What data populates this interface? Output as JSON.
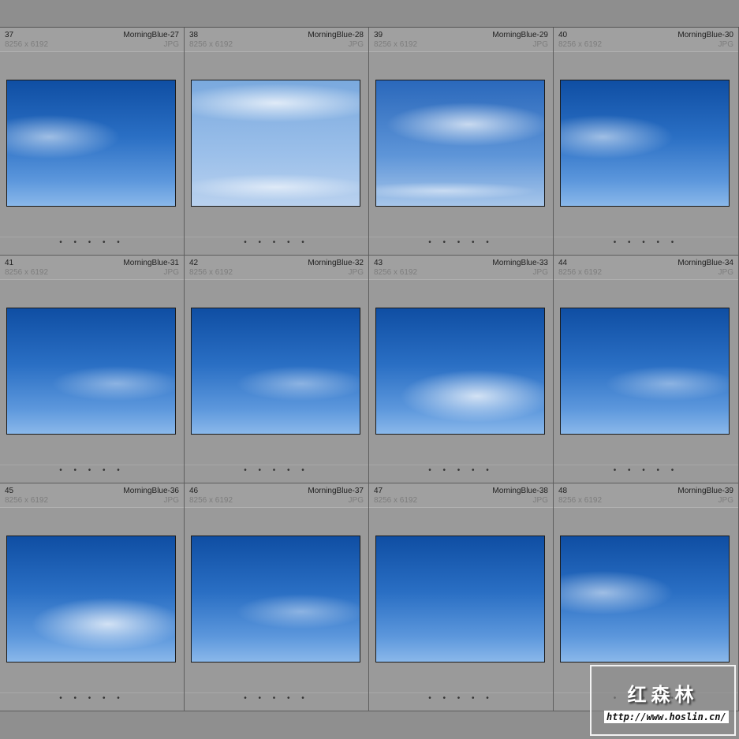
{
  "photos": [
    {
      "num": "37",
      "name": "MorningBlue-27",
      "dims": "8256 x 6192",
      "type": "JPG",
      "style": "c1"
    },
    {
      "num": "38",
      "name": "MorningBlue-28",
      "dims": "8256 x 6192",
      "type": "JPG",
      "style": "c2"
    },
    {
      "num": "39",
      "name": "MorningBlue-29",
      "dims": "8256 x 6192",
      "type": "JPG",
      "style": "c3"
    },
    {
      "num": "40",
      "name": "MorningBlue-30",
      "dims": "8256 x 6192",
      "type": "JPG",
      "style": "c1"
    },
    {
      "num": "41",
      "name": "MorningBlue-31",
      "dims": "8256 x 6192",
      "type": "JPG",
      "style": "c5"
    },
    {
      "num": "42",
      "name": "MorningBlue-32",
      "dims": "8256 x 6192",
      "type": "JPG",
      "style": "c5"
    },
    {
      "num": "43",
      "name": "MorningBlue-33",
      "dims": "8256 x 6192",
      "type": "JPG",
      "style": "c4"
    },
    {
      "num": "44",
      "name": "MorningBlue-34",
      "dims": "8256 x 6192",
      "type": "JPG",
      "style": "c5"
    },
    {
      "num": "45",
      "name": "MorningBlue-36",
      "dims": "8256 x 6192",
      "type": "JPG",
      "style": "c4"
    },
    {
      "num": "46",
      "name": "MorningBlue-37",
      "dims": "8256 x 6192",
      "type": "JPG",
      "style": "c5"
    },
    {
      "num": "47",
      "name": "MorningBlue-38",
      "dims": "8256 x 6192",
      "type": "JPG",
      "style": "c0"
    },
    {
      "num": "48",
      "name": "MorningBlue-39",
      "dims": "8256 x 6192",
      "type": "JPG",
      "style": "c1"
    }
  ],
  "rating_dots": "• • • • •",
  "watermark": {
    "title": "红森林",
    "url": "http://www.hoslin.cn/"
  }
}
